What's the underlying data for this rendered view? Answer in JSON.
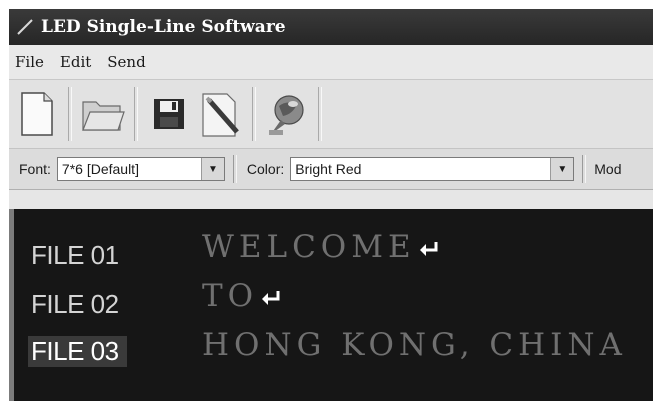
{
  "window": {
    "title": "LED Single-Line Software"
  },
  "menu": [
    "File",
    "Edit",
    "Send"
  ],
  "toolbar": {
    "buttons": [
      "new-file-icon",
      "open-folder-icon",
      "save-icon",
      "edit-pen-icon",
      "send-globe-icon"
    ]
  },
  "fontbar": {
    "font_label": "Font:",
    "font_value": "7*6 [Default]",
    "color_label": "Color:",
    "color_value": "Bright Red",
    "mode_label": "Mod"
  },
  "files": [
    {
      "label": "FILE 01",
      "message": "WELCOME",
      "has_return": true
    },
    {
      "label": "FILE 02",
      "message": "TO",
      "has_return": true
    },
    {
      "label": "FILE 03",
      "message": "HONG KONG, CHINA",
      "has_return": false,
      "selected": true
    }
  ]
}
